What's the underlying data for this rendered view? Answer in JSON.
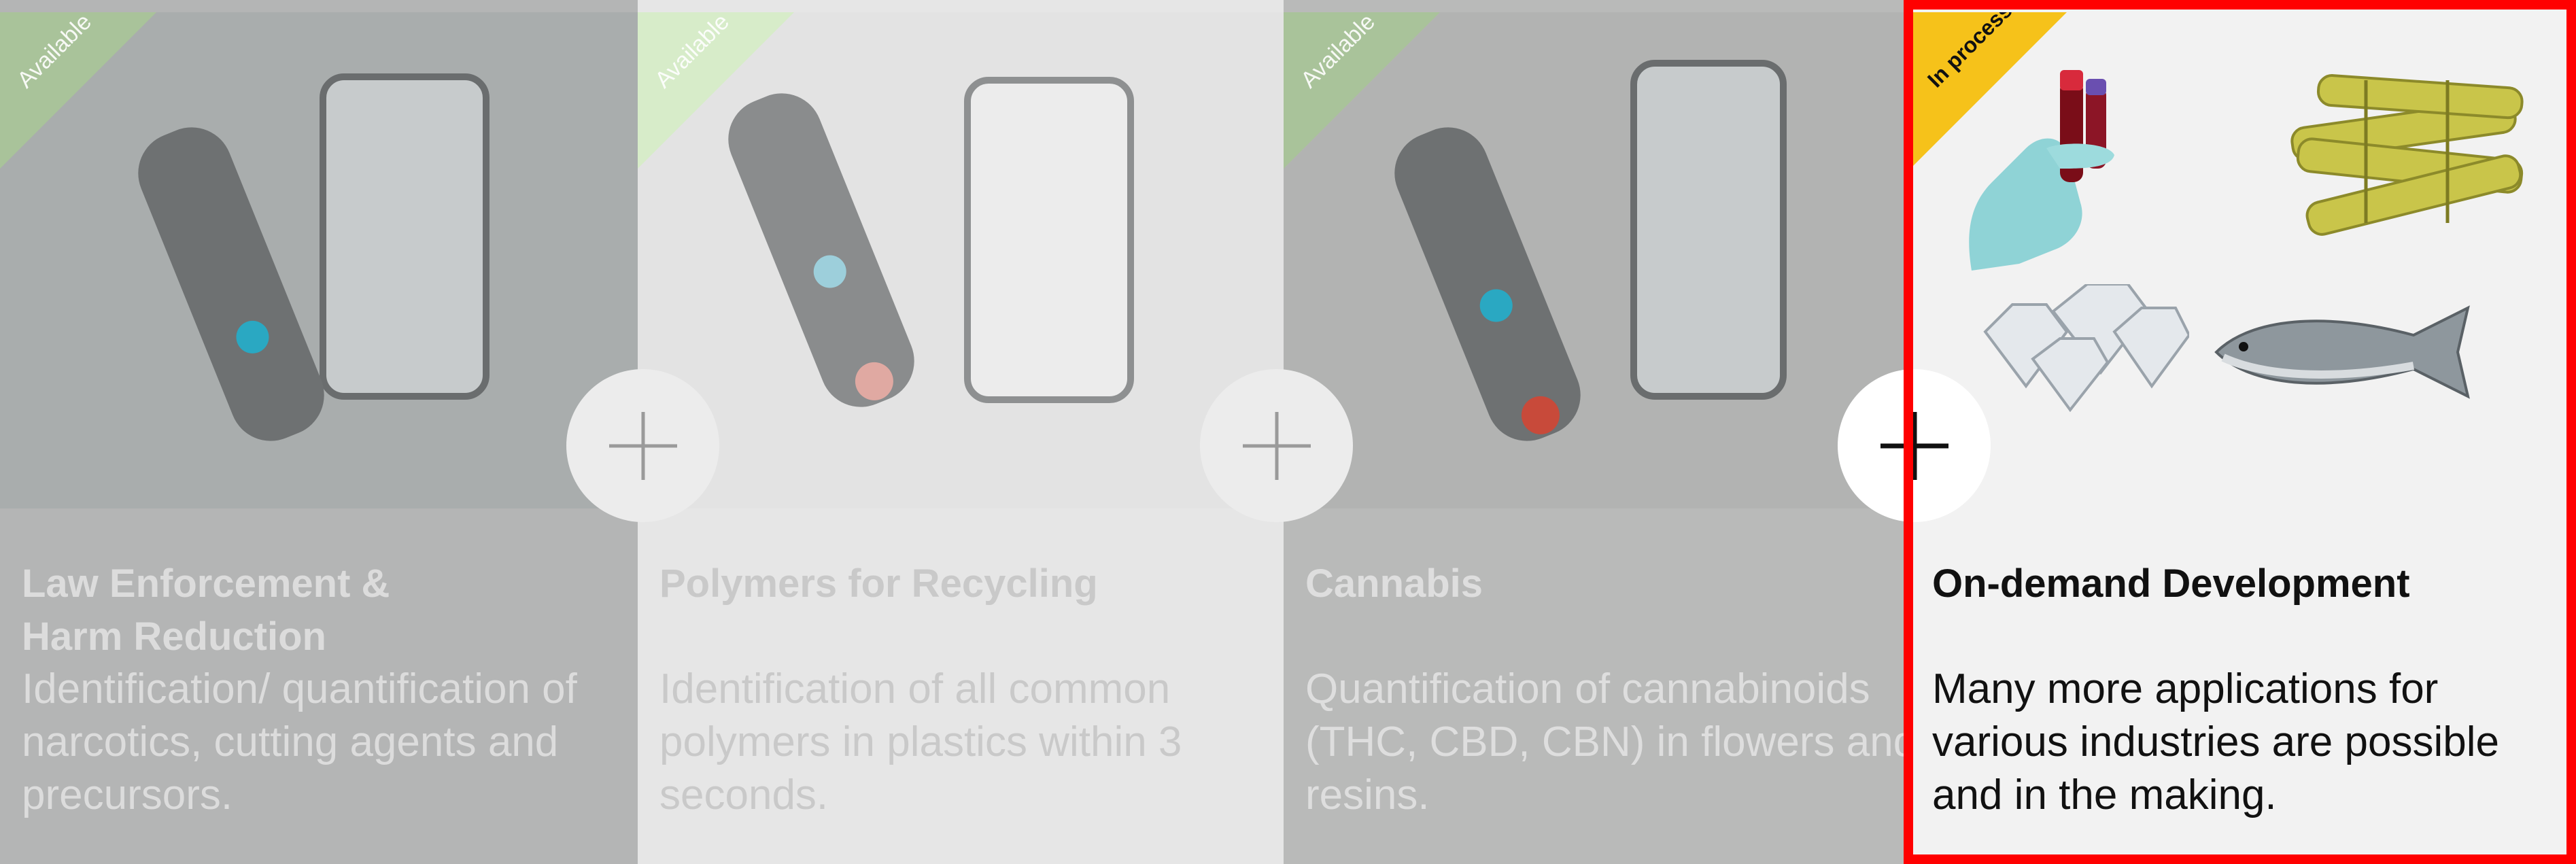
{
  "cards": [
    {
      "badge": "Available",
      "title_line1": "Law Enforcement &",
      "title_line2": "Harm Reduction",
      "description": "Identification/ quantification of narcotics, cutting agents and precursors."
    },
    {
      "badge": "Available",
      "title_line1": "Polymers for Recycling",
      "title_line2": "",
      "description": "Identification of all common polymers in plastics within 3 seconds."
    },
    {
      "badge": "Available",
      "title_line1": "Cannabis",
      "title_line2": "",
      "description": "Quantification of cannabinoids (THC, CBD, CBN) in flowers and resins."
    },
    {
      "badge": "In process",
      "title_line1": "On-demand Development",
      "title_line2": "",
      "description": "Many more applications for various industries are possible and in the making."
    }
  ],
  "icons": {
    "expand": "plus-icon"
  },
  "colors": {
    "available_badge": "#d7ecc9",
    "in_process_badge": "#f6c21a",
    "highlight_frame": "#ff0000",
    "active_text": "#111111"
  }
}
